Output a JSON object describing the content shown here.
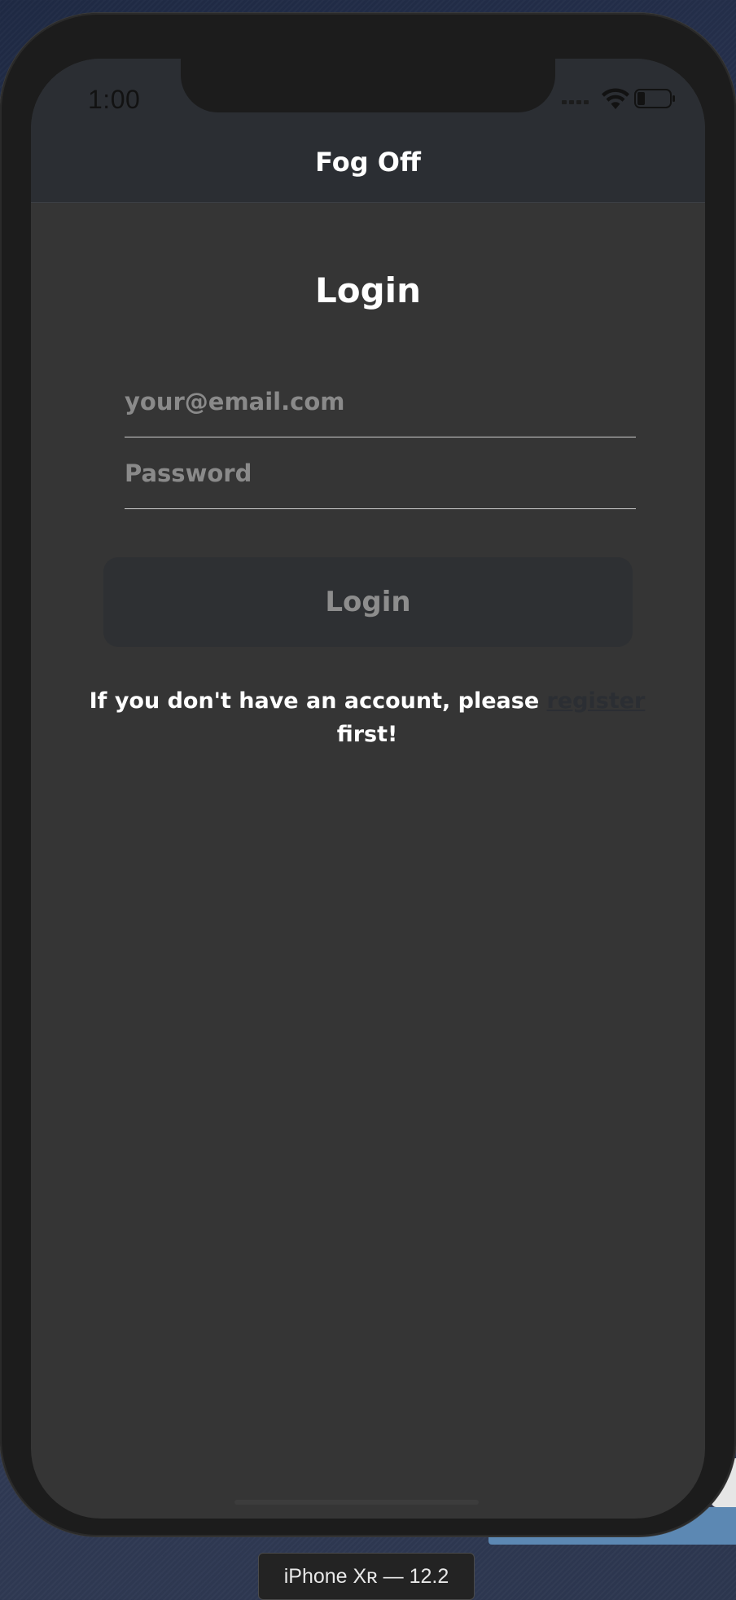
{
  "status_bar": {
    "time": "1:00",
    "icons": [
      "signal-dots-icon",
      "wifi-icon",
      "battery-icon"
    ]
  },
  "nav": {
    "title": "Fog Off"
  },
  "login": {
    "title": "Login",
    "email_placeholder": "your@email.com",
    "email_value": "",
    "password_placeholder": "Password",
    "password_value": "",
    "button_label": "Login"
  },
  "register": {
    "before_link": "If you don't have an account, please ",
    "link_label": "register",
    "after_link": " first!"
  },
  "simulator": {
    "device_label": "iPhone Xʀ — 12.2"
  },
  "colors": {
    "screen_background": "#353535",
    "nav_background": "#2b2e33",
    "button_background": "#2e3033",
    "text": "#ffffff",
    "placeholder": "#8a8a8a"
  }
}
